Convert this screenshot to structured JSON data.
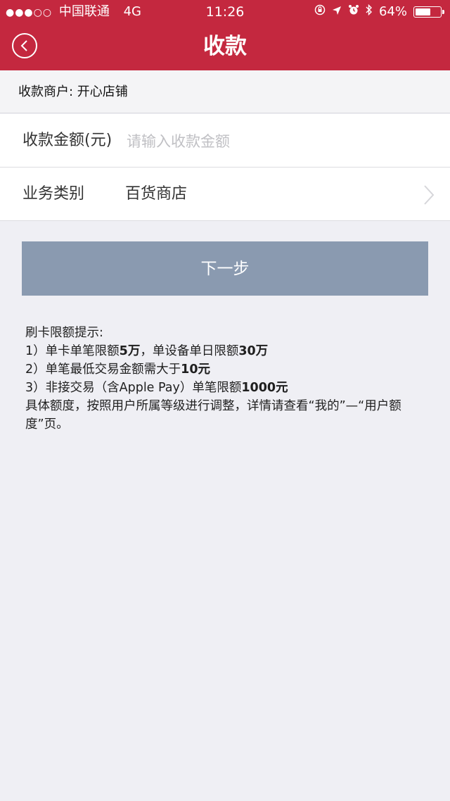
{
  "status_bar": {
    "signal_dots": "●●●○○",
    "carrier": "中国联通",
    "network": "4G",
    "time": "11:26",
    "battery": "64%",
    "battery_level": 0.64
  },
  "navbar": {
    "title": "收款",
    "back_icon": "chevron-left-circle-icon"
  },
  "merchant": {
    "text": "收款商户: 开心店铺"
  },
  "form": {
    "amount_label": "收款金额(元)",
    "amount_placeholder": "请输入收款金额",
    "amount_value": "",
    "type_label": "业务类别",
    "type_value": "百货商店"
  },
  "next_button": "下一步",
  "tips": {
    "title": "刷卡限额提示:",
    "line1_prefix": "1）单卡单笔限额",
    "line1_b1": "5万",
    "line1_mid": "，单设备单日限额",
    "line1_b2": "30万",
    "line2_prefix": "2）单笔最低交易金额需大于",
    "line2_b": "10元",
    "line3_prefix": "3）非接交易（含Apple Pay）单笔限额",
    "line3_b": "1000元",
    "line4": "具体额度，按照用户所属等级进行调整，详情请查看“我的”—“用户额度”页。"
  },
  "colors": {
    "header": "#c4283f",
    "button": "#8a9ab0",
    "background": "#efeff4"
  }
}
